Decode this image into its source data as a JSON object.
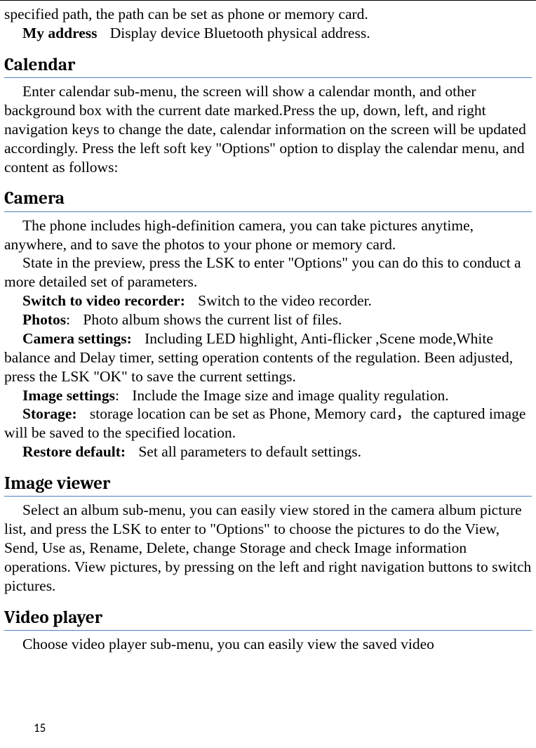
{
  "intro": {
    "line1": "specified path, the path can be set as phone or memory card.",
    "my_address_label": "My address",
    "my_address_desc": "Display device Bluetooth physical address."
  },
  "calendar": {
    "heading": "Calendar",
    "body": "Enter calendar sub-menu, the screen will show a calendar month, and other background box with the current date marked.Press the up, down, left, and right navigation keys to change the date, calendar information on the screen will be updated accordingly. Press the left soft key \"Options\" option to display the calendar menu, and content as follows:"
  },
  "camera": {
    "heading": "Camera",
    "p1": "The phone includes high-definition camera, you can take pictures anytime, anywhere, and to save the photos to your phone or memory card.",
    "p2": "State in the preview, press the LSK to enter \"Options\" you can do this to conduct a more detailed set of parameters.",
    "switch_label": "Switch to video recorder:",
    "switch_desc": "Switch to the video recorder.",
    "photos_label": "Photos",
    "photos_desc": "Photo album shows the current list of files.",
    "camset_label": "Camera settings:",
    "camset_desc": "Including LED highlight, Anti-flicker ,Scene mode,White balance and Delay timer, setting operation contents of the regulation. Been adjusted, press the LSK \"OK\" to save the current settings.",
    "imgset_label": "Image settings",
    "imgset_desc": "Include the Image size and image quality regulation.",
    "storage_label": "Storage:",
    "storage_desc": "storage location can be set as Phone, Memory card，the captured image will be saved to the specified location.",
    "restore_label": "Restore default:",
    "restore_desc": "Set all parameters to default settings."
  },
  "image_viewer": {
    "heading": "Image viewer",
    "body": "Select an album sub-menu, you can easily view stored in the camera album picture list, and press the LSK to enter to \"Options\" to choose the pictures to do the View, Send, Use as, Rename, Delete, change Storage and check Image information operations. View pictures, by pressing on the left and right navigation buttons to switch pictures."
  },
  "video_player": {
    "heading": "Video player",
    "body": "Choose video player sub-menu, you can easily view the saved video"
  },
  "page_number": "15"
}
